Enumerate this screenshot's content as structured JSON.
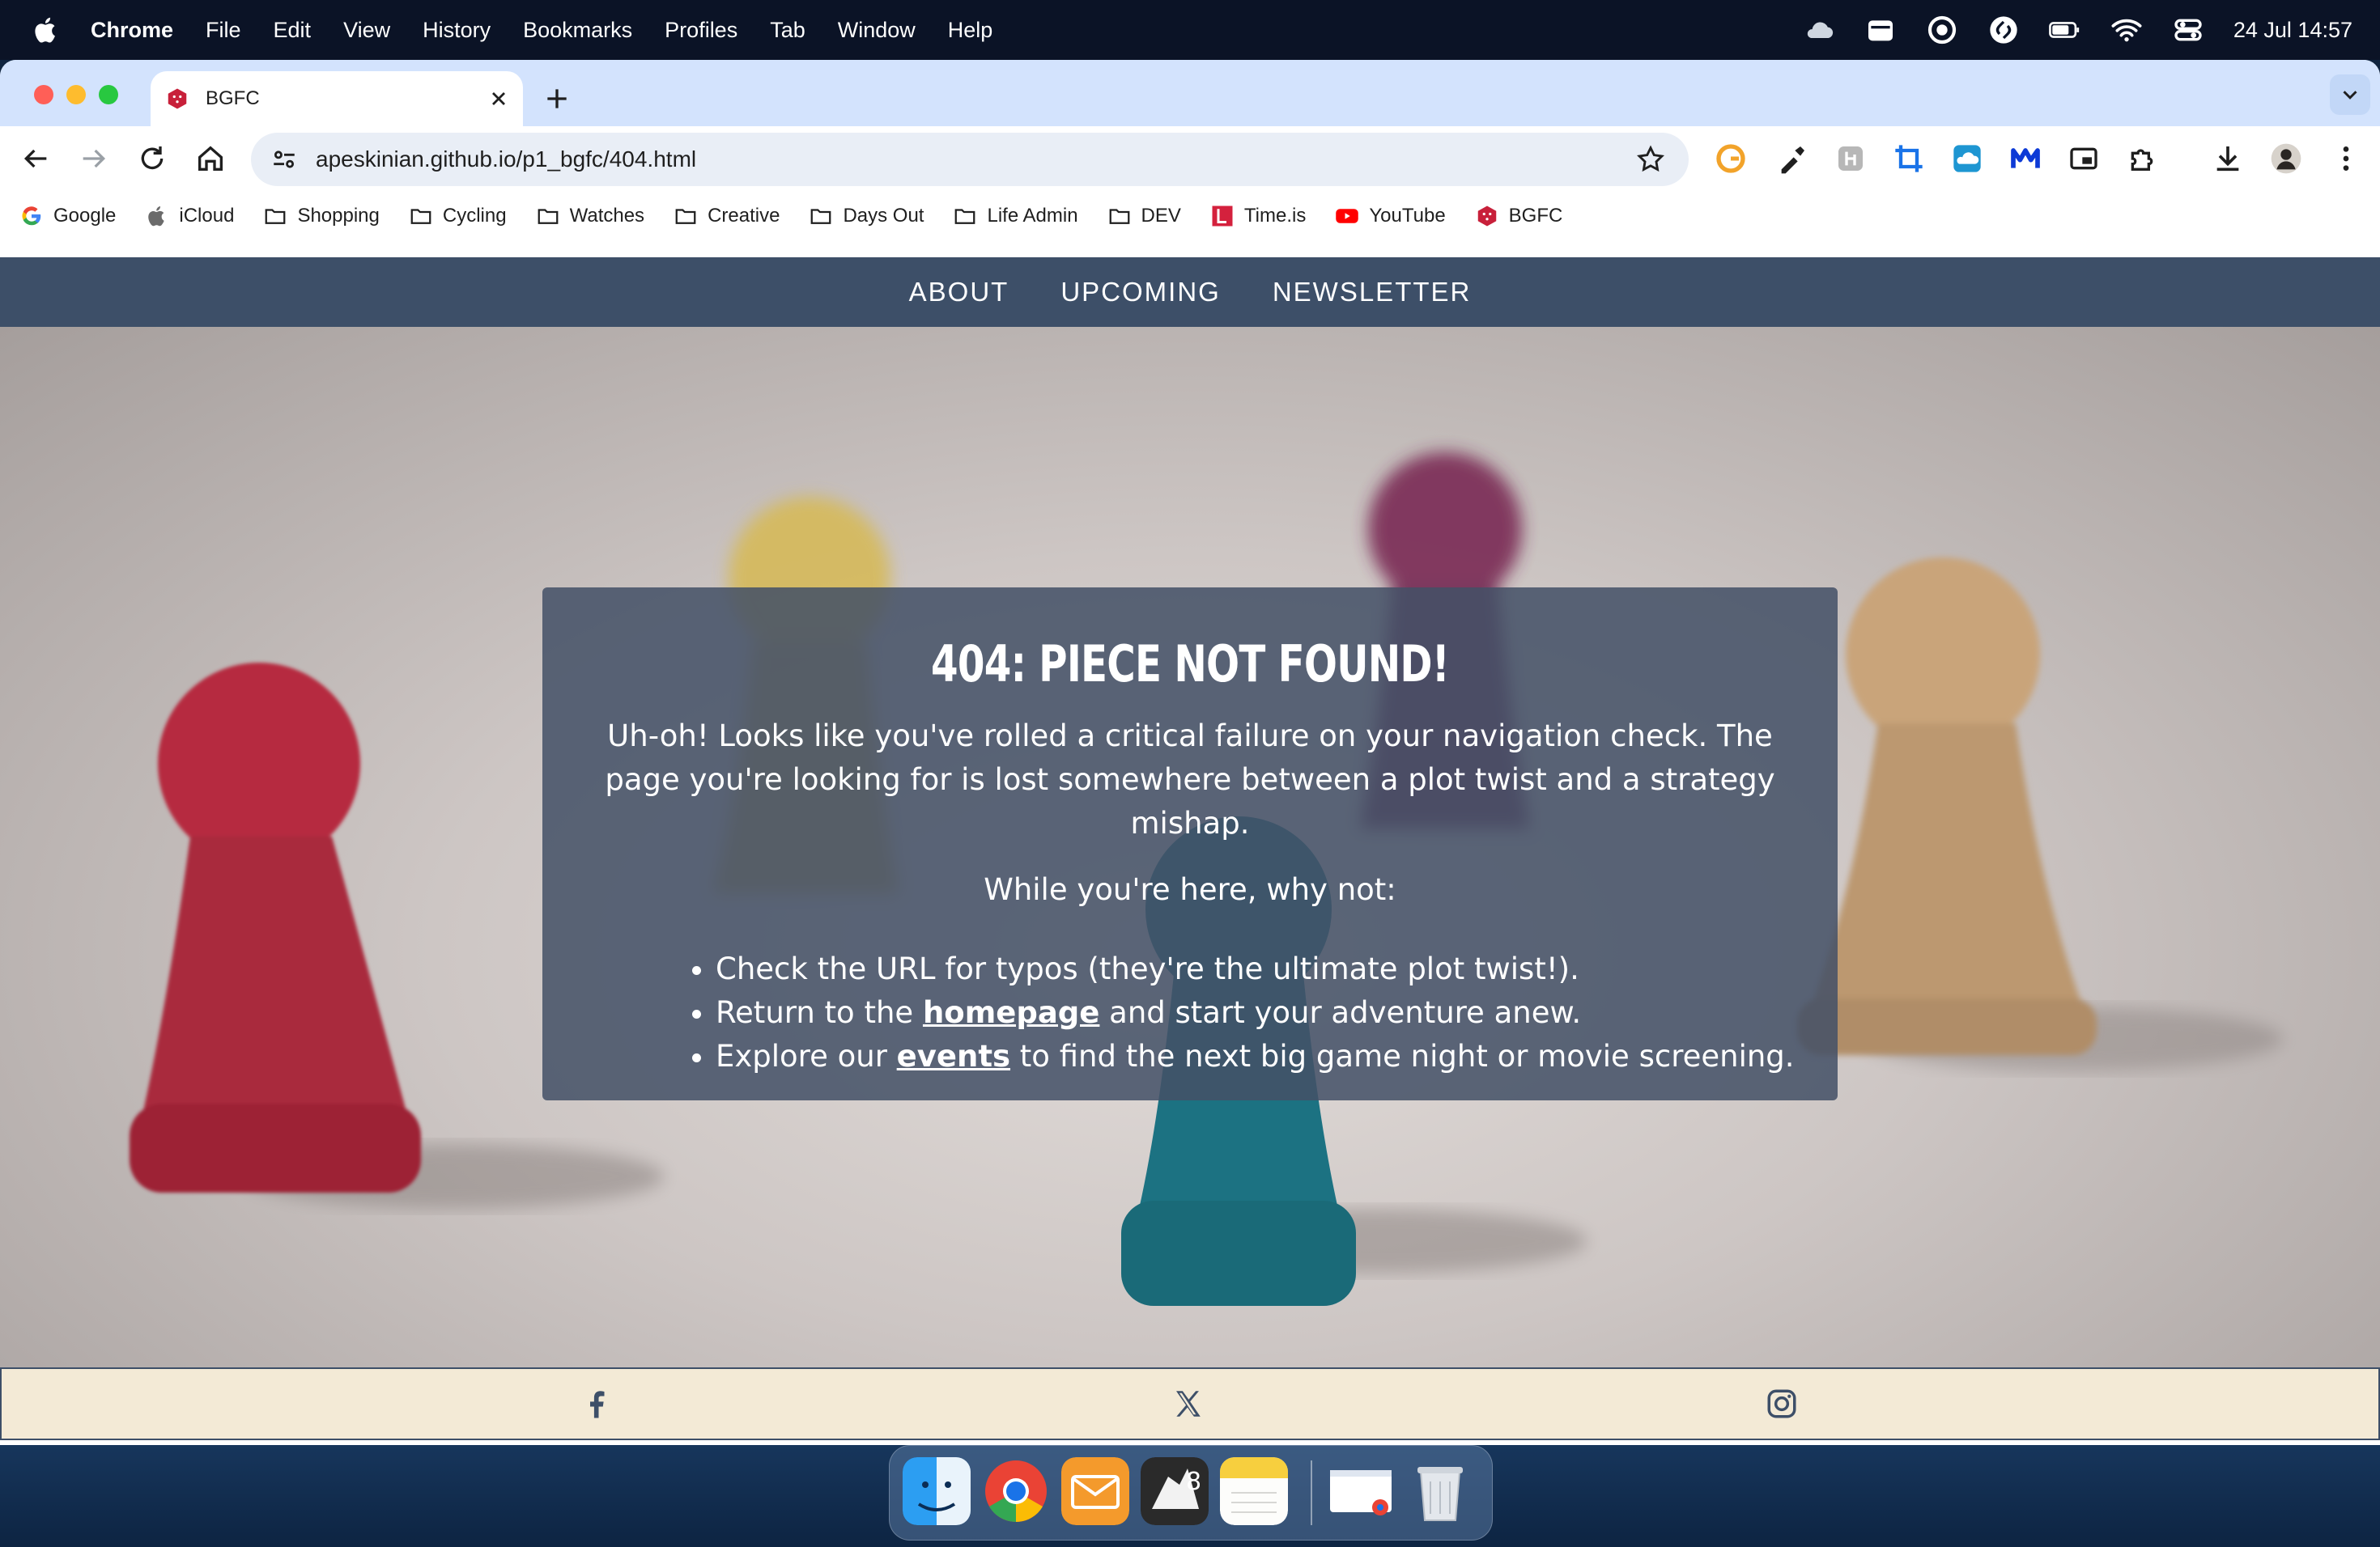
{
  "menubar": {
    "app_name": "Chrome",
    "items": [
      "File",
      "Edit",
      "View",
      "History",
      "Bookmarks",
      "Profiles",
      "Tab",
      "Window",
      "Help"
    ],
    "clock": "24 Jul  14:57",
    "status_icons": [
      "cloud-icon",
      "calendar-icon",
      "focus-icon",
      "shazam-icon",
      "battery-icon",
      "wifi-icon",
      "control-center-icon"
    ]
  },
  "browser": {
    "tab": {
      "title": "BGFC"
    },
    "address": "apeskinian.github.io/p1_bgfc/404.html",
    "extensions": [
      "grammarly-icon",
      "eyedropper-icon",
      "extension-h-icon",
      "crop-icon",
      "cloud-extension-icon",
      "malwarebytes-icon",
      "picture-in-picture-icon",
      "puzzle-icon",
      "download-icon",
      "profile-avatar",
      "more-icon"
    ],
    "bookmarks": [
      {
        "label": "Google",
        "icon": "google-icon"
      },
      {
        "label": "iCloud",
        "icon": "apple-icon"
      },
      {
        "label": "Shopping",
        "icon": "folder-icon"
      },
      {
        "label": "Cycling",
        "icon": "folder-icon"
      },
      {
        "label": "Watches",
        "icon": "folder-icon"
      },
      {
        "label": "Creative",
        "icon": "folder-icon"
      },
      {
        "label": "Days Out",
        "icon": "folder-icon"
      },
      {
        "label": "Life Admin",
        "icon": "folder-icon"
      },
      {
        "label": "DEV",
        "icon": "folder-icon"
      },
      {
        "label": "Time.is",
        "icon": "timeis-icon"
      },
      {
        "label": "YouTube",
        "icon": "youtube-icon"
      },
      {
        "label": "BGFC",
        "icon": "dice-icon"
      }
    ]
  },
  "site": {
    "nav": [
      "ABOUT",
      "UPCOMING",
      "NEWSLETTER"
    ],
    "error": {
      "title": "404: PIECE NOT FOUND!",
      "message": "Uh-oh! Looks like you've rolled a critical failure on your navigation check. The page you're looking for is lost somewhere between a plot twist and a strategy mishap.",
      "prompt": "While you're here, why not:",
      "tips": [
        {
          "before": "Check the URL for typos (they're the ultimate plot twist!).",
          "link": "",
          "after": ""
        },
        {
          "before": "Return to the ",
          "link": "homepage",
          "after": " and start your adventure anew."
        },
        {
          "before": "Explore our ",
          "link": "events",
          "after": " to find the next big game night or movie screening."
        }
      ]
    },
    "footer_icons": [
      "facebook-icon",
      "x-icon",
      "instagram-icon"
    ]
  },
  "dock": [
    "finder-icon",
    "chrome-icon",
    "mail-icon",
    "game-app-icon",
    "notes-icon",
    "chrome-window-thumbnail",
    "trash-icon"
  ],
  "colors": {
    "nav_bg": "#3d4f68",
    "card_bg": "#435066",
    "footer_bg": "#f3ead6",
    "tabstrip": "#d3e3fd"
  }
}
